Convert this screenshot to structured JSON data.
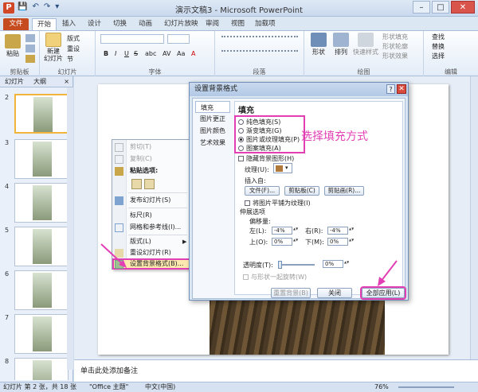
{
  "window": {
    "title": "演示文稿3 - Microsoft PowerPoint",
    "controls": {
      "minimize": "–",
      "maximize": "□",
      "close": "✕"
    }
  },
  "qat": {
    "save": "💾",
    "undo": "↶",
    "redo": "↷",
    "more": "▾"
  },
  "ribbon_tabs": [
    "文件",
    "开始",
    "插入",
    "设计",
    "切换",
    "动画",
    "幻灯片放映",
    "审阅",
    "视图",
    "加载项"
  ],
  "ribbon": {
    "clipboard": {
      "paste": "粘贴",
      "label": "剪贴板"
    },
    "slides": {
      "new_slide": "新建\n幻灯片",
      "layout": "版式",
      "reset": "重设",
      "section": "节",
      "label": "幻灯片"
    },
    "font": {
      "bold": "B",
      "italic": "I",
      "underline": "U",
      "strike": "S",
      "shadow": "abc",
      "spacing": "AV",
      "case": "Aa",
      "color": "A",
      "label": "字体"
    },
    "paragraph": {
      "label": "段落"
    },
    "drawing": {
      "shapes": "形状",
      "arrange": "排列",
      "quick_styles": "快速样式",
      "fill": "形状填充",
      "outline": "形状轮廓",
      "effects": "形状效果",
      "label": "绘图"
    },
    "editing": {
      "find": "查找",
      "replace": "替换",
      "select": "选择",
      "label": "编辑"
    }
  },
  "left_panel": {
    "tabs": [
      "幻灯片",
      "大纲"
    ],
    "close": "×",
    "slide_numbers": [
      "2",
      "3",
      "4",
      "5",
      "6",
      "7",
      "8"
    ]
  },
  "context_menu": {
    "items": [
      {
        "label": "剪切(T)",
        "enabled": false
      },
      {
        "label": "复制(C)",
        "enabled": false
      },
      {
        "label": "粘贴选项:",
        "enabled": true
      },
      {
        "label": "发布幻灯片(S)",
        "enabled": true
      },
      {
        "label": "标尺(R)",
        "enabled": true
      },
      {
        "label": "网格和参考线(I)...",
        "enabled": true
      },
      {
        "label": "版式(L)",
        "enabled": true
      },
      {
        "label": "重设幻灯片(R)",
        "enabled": true
      },
      {
        "label": "设置背景格式(B)...",
        "enabled": true
      }
    ]
  },
  "dialog": {
    "title": "设置背景格式",
    "help": "?",
    "close": "✕",
    "nav": [
      "填充",
      "图片更正",
      "图片颜色",
      "艺术效果"
    ],
    "section": "填充",
    "fill_options": [
      {
        "label": "纯色填充(S)",
        "selected": false
      },
      {
        "label": "渐变填充(G)",
        "selected": false
      },
      {
        "label": "图片或纹理填充(P)",
        "selected": true
      },
      {
        "label": "图案填充(A)",
        "selected": false
      }
    ],
    "hide_bg_graphics": "隐藏背景图形(H)",
    "texture_label": "纹理(U):",
    "insert_from": "插入自:",
    "insert_buttons": [
      "文件(F)...",
      "剪贴板(C)",
      "剪贴画(R)..."
    ],
    "tile": "将图片平铺为纹理(I)",
    "stretch_options": "伸展选项",
    "offsets_label": "偏移量:",
    "offsets": [
      {
        "label": "左(L):",
        "value": "-4%"
      },
      {
        "label": "右(R):",
        "value": "-4%"
      },
      {
        "label": "上(O):",
        "value": "0%"
      },
      {
        "label": "下(M):",
        "value": "0%"
      }
    ],
    "transparency_label": "透明度(T):",
    "transparency_value": "0%",
    "rotate_with_shape": "与形状一起旋转(W)",
    "footer_buttons": [
      "重置背景(B)",
      "关闭",
      "全部应用(L)"
    ]
  },
  "annotation": "选择填充方式",
  "notes_placeholder": "单击此处添加备注",
  "status": {
    "slide_info": "幻灯片 第 2 张，共 18 张",
    "theme": "\"Office 主题\"",
    "language": "中文(中国)",
    "zoom": "76%"
  },
  "colors": {
    "accent_file_tab": "#c64b1f",
    "highlight": "#e23fb4",
    "selection": "#f2b43a"
  }
}
